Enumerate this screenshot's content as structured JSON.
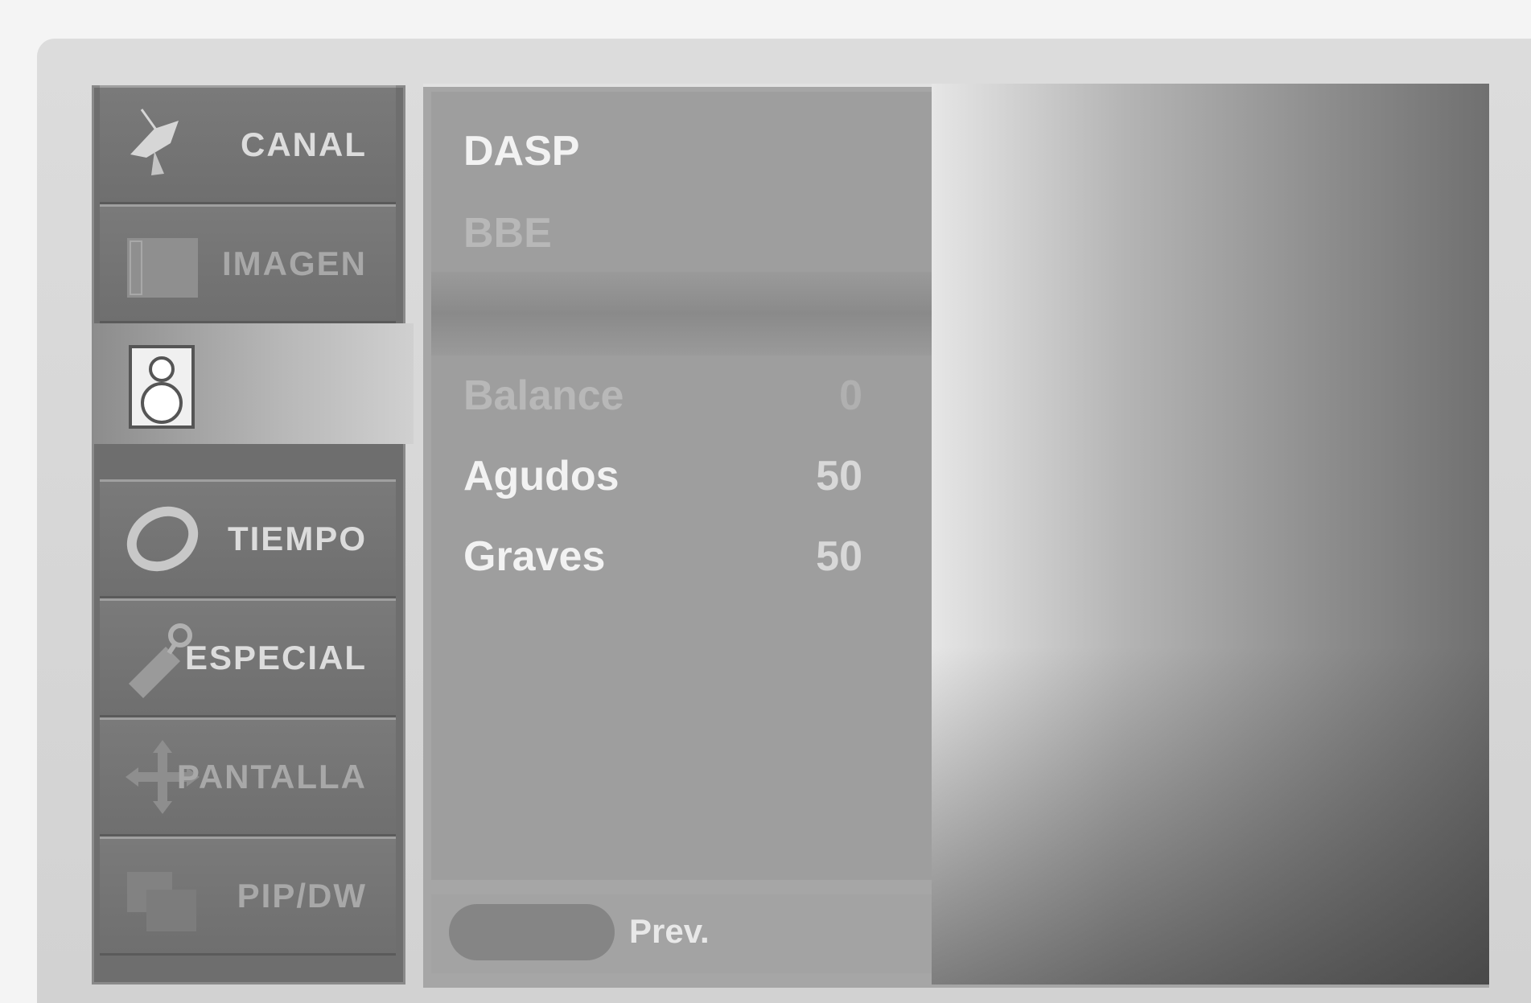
{
  "sidebar": {
    "tabs": [
      {
        "label": "CANAL",
        "icon": "satellite-dish-icon"
      },
      {
        "label": "IMAGEN",
        "icon": "picture-frame-icon"
      },
      {
        "label": "",
        "icon": "speaker-icon",
        "active": true
      },
      {
        "label": "TIEMPO",
        "icon": "clock-ring-icon"
      },
      {
        "label": "ESPECIAL",
        "icon": "tag-icon"
      },
      {
        "label": "PANTALLA",
        "icon": "move-arrows-icon"
      },
      {
        "label": "PIP/DW",
        "icon": "pip-windows-icon"
      }
    ]
  },
  "sound_menu": {
    "top_items": [
      "DASP",
      "BBE"
    ],
    "settings": [
      {
        "name": "Balance",
        "value": "0"
      },
      {
        "name": "Agudos",
        "value": "50"
      },
      {
        "name": "Graves",
        "value": "50"
      }
    ],
    "prev_label": "Prev."
  }
}
